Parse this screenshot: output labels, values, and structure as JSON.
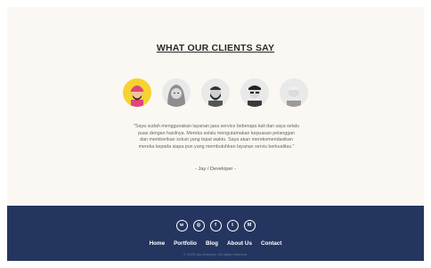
{
  "section": {
    "title": "WHAT OUR CLIENTS SAY"
  },
  "avatars": [
    {
      "name": "avatar-turban-man",
      "active": true
    },
    {
      "name": "avatar-hijab-woman",
      "active": false
    },
    {
      "name": "avatar-beard-man",
      "active": false
    },
    {
      "name": "avatar-sunglasses-man",
      "active": false
    },
    {
      "name": "avatar-old-man",
      "active": false
    }
  ],
  "testimonial": {
    "quote": "\"Saya sudah menggunakan layanan jasa service beberapa kali dan saya selalu puas dengan hasilnya. Mereka selalu mengutamakan kepuasan pelanggan dan memberikan solusi yang tepat waktu. Saya akan merekomendasikan mereka kepada siapa pun yang membutuhkan layanan servis berkualitas.\"",
    "author": "- Jay / Developer -"
  },
  "footer": {
    "socials": [
      {
        "icon": "whatsapp-icon",
        "glyph": "w"
      },
      {
        "icon": "instagram-icon",
        "glyph": "◎"
      },
      {
        "icon": "facebook-icon",
        "glyph": "f"
      },
      {
        "icon": "twitter-icon",
        "glyph": "t"
      },
      {
        "icon": "medium-icon",
        "glyph": "M"
      }
    ],
    "nav": [
      "Home",
      "Portfolio",
      "Blog",
      "About Us",
      "Contact"
    ],
    "copyright": "© 2023 Jay Andriyan. All rights reserved."
  },
  "colors": {
    "background": "#fbf8f3",
    "footer": "#243560",
    "active_avatar": "#f6d233"
  }
}
